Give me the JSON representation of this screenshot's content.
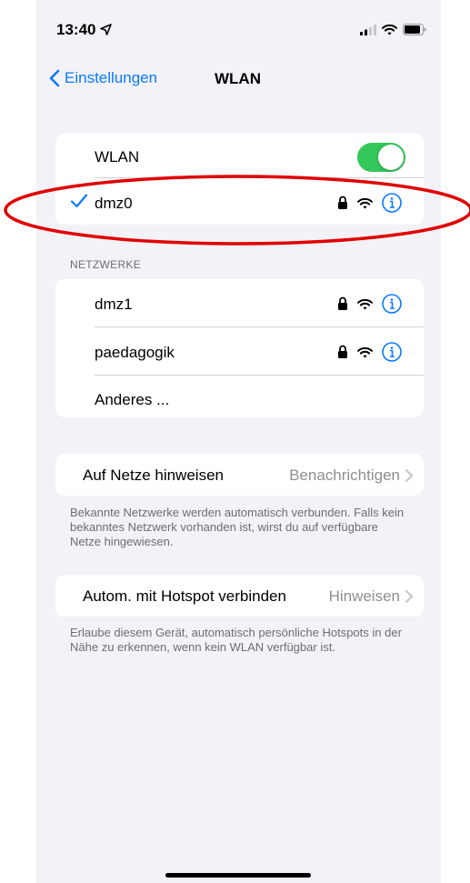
{
  "status_bar": {
    "time": "13:40"
  },
  "nav": {
    "back_label": "Einstellungen",
    "title": "WLAN"
  },
  "wlan_group": {
    "toggle_label": "WLAN",
    "toggle_on": true,
    "connected_network": "dmz0"
  },
  "networks": {
    "header": "NETZWERKE",
    "items": [
      {
        "name": "dmz1"
      },
      {
        "name": "paedagogik"
      }
    ],
    "other_label": "Anderes ..."
  },
  "ask_to_join": {
    "label": "Auf Netze hinweisen",
    "value": "Benachrichtigen",
    "footnote": "Bekannte Netzwerke werden automatisch verbunden. Falls kein bekanntes Netzwerk vorhanden ist, wirst du auf verfügbare Netze hingewiesen."
  },
  "hotspot": {
    "label": "Autom. mit Hotspot verbinden",
    "value": "Hinweisen",
    "footnote": "Erlaube diesem Gerät, automatisch persönliche Hotspots in der Nähe zu erkennen, wenn kein WLAN verfügbar ist."
  },
  "colors": {
    "accent": "#0a7aff",
    "toggle_on": "#34c759",
    "annotation": "#e00000",
    "background": "#f2f2f7"
  }
}
